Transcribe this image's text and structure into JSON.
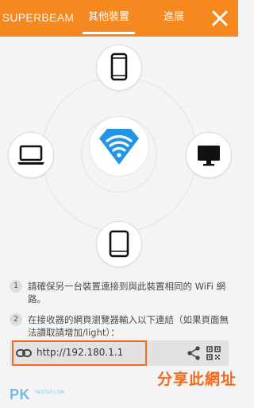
{
  "header": {
    "tabs": [
      {
        "label": "SUPERBEAM"
      },
      {
        "label": "其他裝置"
      },
      {
        "label": "進展"
      }
    ],
    "active_tab": "其他裝置",
    "close_icon": "close-icon"
  },
  "devices": [
    {
      "name": "phone",
      "icon": "smartphone-icon"
    },
    {
      "name": "laptop",
      "icon": "laptop-icon"
    },
    {
      "name": "monitor",
      "icon": "desktop-monitor-icon"
    },
    {
      "name": "tablet",
      "icon": "tablet-icon"
    }
  ],
  "center_icon": "wifi-diamond-icon",
  "steps": [
    {
      "num": "1",
      "text": "請確保另一台裝置連接到與此裝置相同的 WiFi 網路。"
    },
    {
      "num": "2",
      "text": "在接收器的網頁瀏覽器輸入以下連結（如果頁面無法讀取請增加/light）："
    }
  ],
  "link_bar": {
    "url": "http://192.180.1.1",
    "link_icon": "link-icon",
    "share_icon": "share-icon",
    "qr_icon": "qr-code-icon"
  },
  "annotation": {
    "caption": "分享此網址"
  },
  "watermark": {
    "brand": "PK",
    "sub": "PKSTEP.COM"
  },
  "colors": {
    "header": "#f5891f",
    "accent_blue": "#2196e8",
    "highlight": "#f06a1f"
  }
}
